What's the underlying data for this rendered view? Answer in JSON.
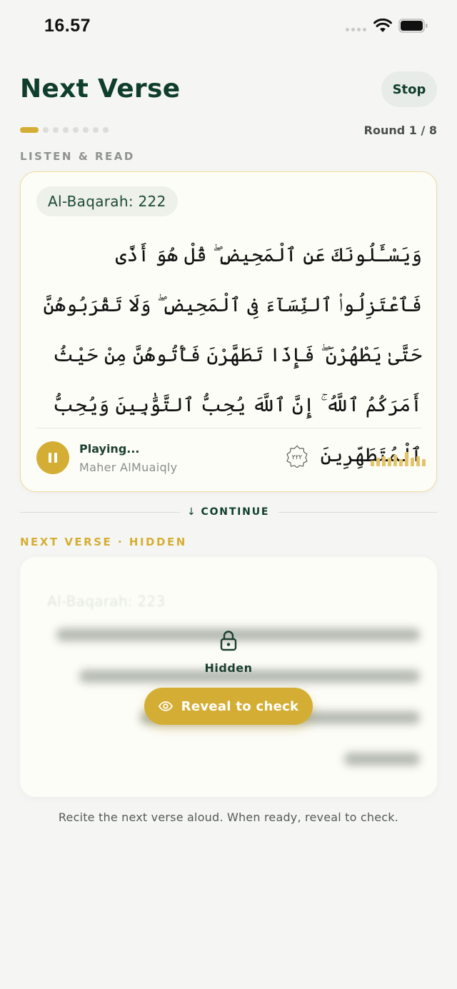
{
  "status_bar": {
    "time": "16.57"
  },
  "header": {
    "title": "Next Verse",
    "stop_label": "Stop"
  },
  "progress": {
    "current_round": 1,
    "total_rounds": 8,
    "round_label": "Round 1 / 8"
  },
  "listen_section": {
    "label": "LISTEN & READ",
    "reference": "Al-Baqarah: 222",
    "arabic_text": "وَيَسْـَٔلُونَكَ عَنِ ٱلْمَحِيضِ ۖ قُلْ هُوَ أَذًى فَٱعْتَزِلُوا۟ ٱلنِّسَآءَ فِى ٱلْمَحِيضِ ۖ وَلَا تَقْرَبُوهُنَّ حَتَّىٰ يَطْهُرْنَ ۖ فَإِذَا تَطَهَّرْنَ فَأْتُوهُنَّ مِنْ حَيْثُ أَمَرَكُمُ ٱللَّهُ ۚ إِنَّ ٱللَّهَ يُحِبُّ ٱلتَّوَّٰبِينَ وَيُحِبُّ ٱلْمُتَطَهِّرِينَ",
    "ayah_number": "٢٢٢",
    "player": {
      "status": "Playing...",
      "reciter": "Maher AlMuaiqly"
    }
  },
  "continue_label": "CONTINUE",
  "next_section": {
    "label": "NEXT VERSE · HIDDEN",
    "reference": "Al-Baqarah: 223",
    "hidden_label": "Hidden",
    "reveal_label": "Reveal to check"
  },
  "hint": "Recite the next verse aloud. When ready, reveal to check.",
  "colors": {
    "accent_gold": "#d4ae34",
    "primary_green": "#0f3d2e",
    "background": "#f5f6f3",
    "card": "#fdfdf7"
  },
  "icons": [
    "signal-icon",
    "wifi-icon",
    "battery-icon",
    "pause-icon",
    "waveform-icon",
    "arrow-down-icon",
    "lock-icon",
    "eye-icon"
  ]
}
